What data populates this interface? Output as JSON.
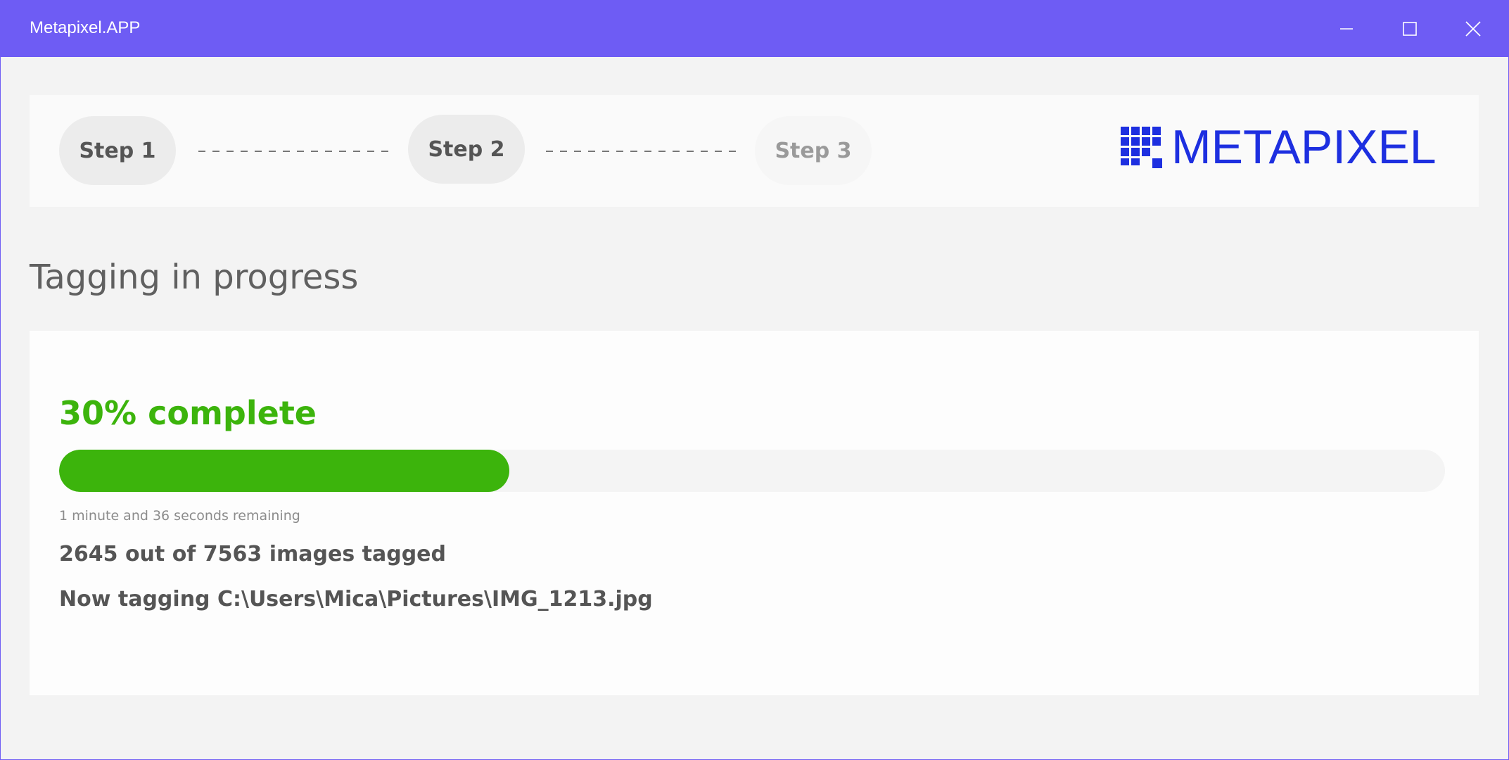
{
  "window": {
    "title": "Metapixel.APP",
    "titlebar_color": "#6e5cf4",
    "controls": [
      "minimize-icon",
      "maximize-icon",
      "close-icon"
    ]
  },
  "steps": [
    {
      "label": "Step 1",
      "state": "done"
    },
    {
      "label": "Step 2",
      "state": "current"
    },
    {
      "label": "Step 3",
      "state": "pending"
    }
  ],
  "logo": {
    "text": "METAPIXEL",
    "color": "#1d2fe0"
  },
  "page_title": "Tagging in progress",
  "progress": {
    "percent_label": "30% complete",
    "fill_fraction": 0.325,
    "color": "#3cb40c",
    "remaining": "1 minute and 36 seconds remaining",
    "count": "2645 out of 7563 images tagged",
    "current_file": "Now tagging C:\\Users\\Mica\\Pictures\\IMG_1213.jpg"
  }
}
